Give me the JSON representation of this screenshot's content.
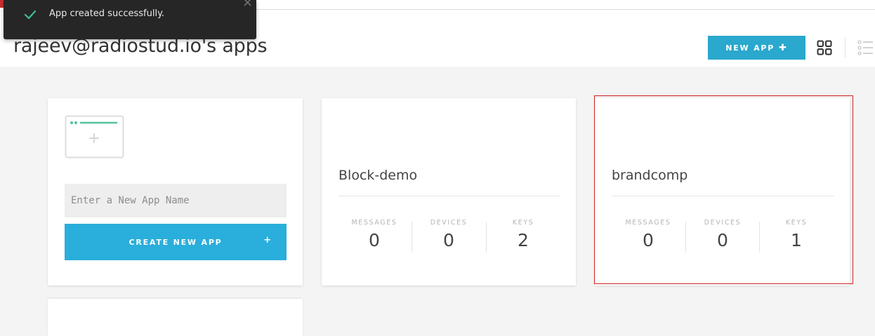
{
  "toast": {
    "message": "App created successfully.",
    "close_glyph": "×",
    "icon": "check-icon"
  },
  "header": {
    "title": "rajeev@radiostud.io's apps",
    "new_app_label": "NEW APP",
    "new_app_plus": "✚",
    "view_icons": [
      "grid-view-icon",
      "list-view-icon"
    ]
  },
  "create_card": {
    "input_placeholder": "Enter a New App Name",
    "button_label": "CREATE NEW APP",
    "button_plus": "+"
  },
  "apps": [
    {
      "name": "Block-demo",
      "stats": [
        {
          "label": "MESSAGES",
          "value": "0"
        },
        {
          "label": "DEVICES",
          "value": "0"
        },
        {
          "label": "KEYS",
          "value": "2"
        }
      ]
    },
    {
      "name": "brandcomp",
      "stats": [
        {
          "label": "MESSAGES",
          "value": "0"
        },
        {
          "label": "DEVICES",
          "value": "0"
        },
        {
          "label": "KEYS",
          "value": "1"
        }
      ]
    }
  ],
  "colors": {
    "accent": "#2aa8cd",
    "toast_bg": "#262626",
    "check": "#3fbf8f",
    "highlight": "#cc2222",
    "illustration": "#53c29a"
  }
}
